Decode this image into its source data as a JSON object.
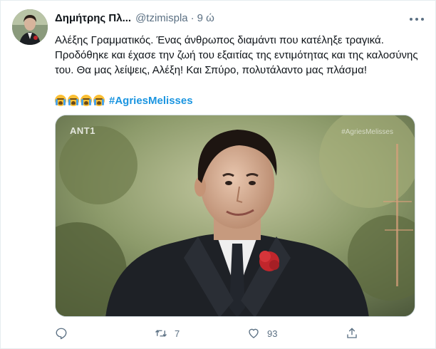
{
  "tweet": {
    "author_name": "Δημήτρης Πλ...",
    "handle": "@tzimispla",
    "separator": "·",
    "time": "9 ώ",
    "text": "Αλέξης Γραμματικός. Ένας άνθρωπος διαμάντι που κατέληξε τραγικά. Προδόθηκε και έχασε την ζωή του εξαιτίας της εντιμότητας και της καλοσύνης του. Θα μας λείψεις, Αλέξη! Και Σπύρο, πολυτάλαντο μας πλάσμα!",
    "hashtag": "#AgriesMelisses",
    "emojis": [
      "loudly-crying-face",
      "loudly-crying-face",
      "loudly-crying-face",
      "loudly-crying-face"
    ]
  },
  "media": {
    "channel_logo": "ANT1",
    "watermark": "#AgriesMelisses"
  },
  "actions": {
    "reply_icon": "reply-icon",
    "retweet_count": "7",
    "like_count": "93",
    "share_icon": "share-icon"
  },
  "colors": {
    "hashtag": "#1b95e0",
    "secondary_text": "#5b7083",
    "border": "#e6ecf0"
  }
}
